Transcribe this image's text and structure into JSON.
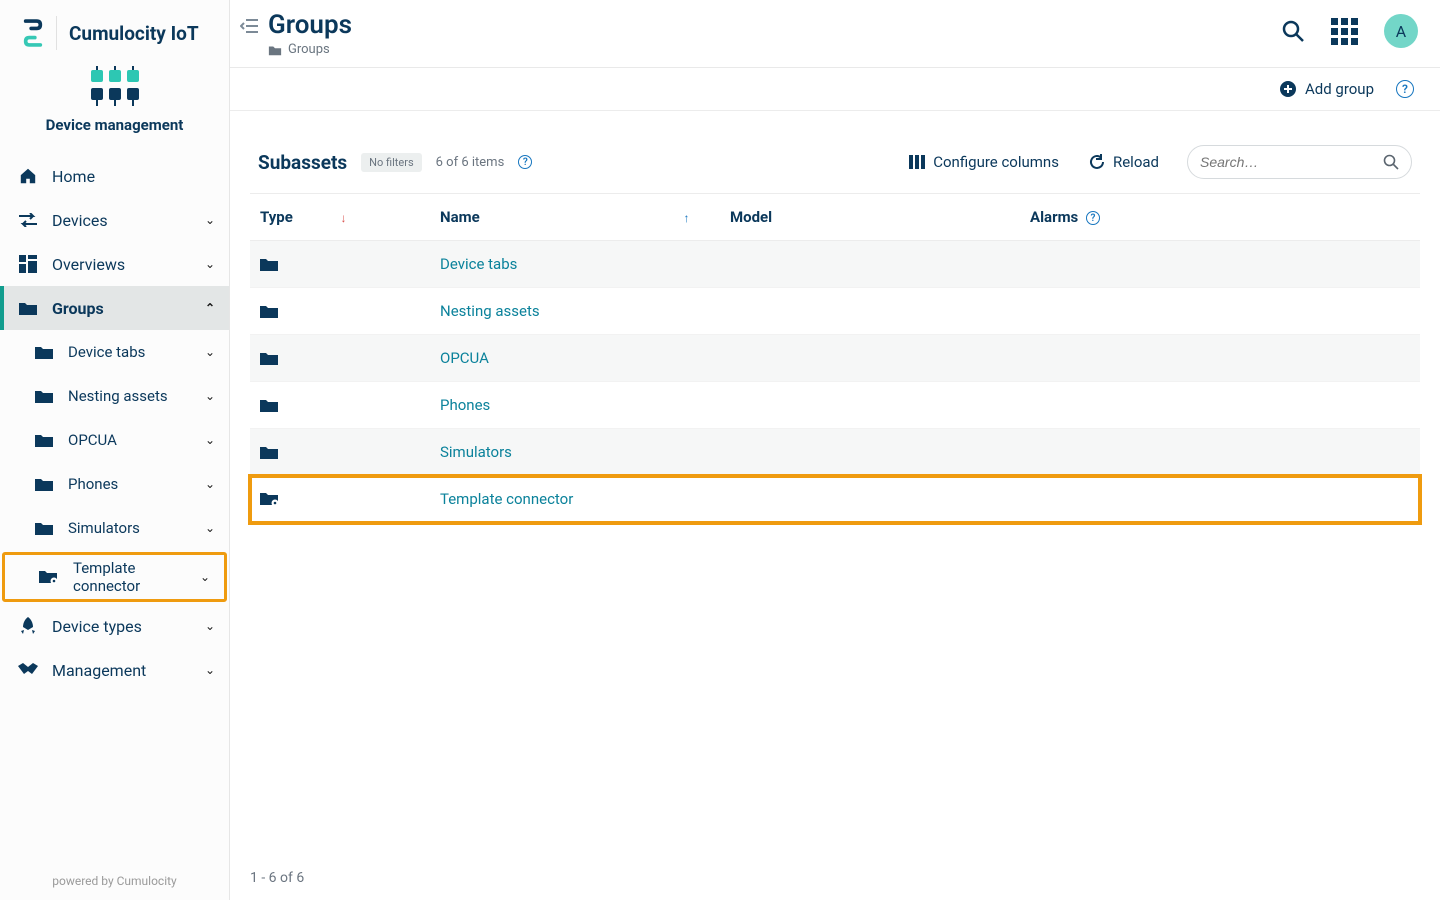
{
  "brand": {
    "name": "Cumulocity IoT"
  },
  "module": {
    "label": "Device management"
  },
  "nav": [
    {
      "label": "Home",
      "icon": "home",
      "expandable": false
    },
    {
      "label": "Devices",
      "icon": "swap",
      "expandable": true
    },
    {
      "label": "Overviews",
      "icon": "dashboard",
      "expandable": true
    },
    {
      "label": "Groups",
      "icon": "folder",
      "expandable": true,
      "active": true,
      "expanded": true,
      "children": [
        {
          "label": "Device tabs",
          "icon": "folder"
        },
        {
          "label": "Nesting assets",
          "icon": "folder"
        },
        {
          "label": "OPCUA",
          "icon": "folder"
        },
        {
          "label": "Phones",
          "icon": "folder"
        },
        {
          "label": "Simulators",
          "icon": "folder"
        },
        {
          "label": "Template connector",
          "icon": "folder-gear",
          "highlight": true
        }
      ]
    },
    {
      "label": "Device types",
      "icon": "rocket",
      "expandable": true
    },
    {
      "label": "Management",
      "icon": "handshake",
      "expandable": true
    }
  ],
  "footer": {
    "powered": "powered by Cumulocity"
  },
  "header": {
    "title": "Groups",
    "crumb": "Groups",
    "avatar": "A"
  },
  "actionbar": {
    "add_group": "Add group"
  },
  "panel": {
    "title": "Subassets",
    "no_filters": "No filters",
    "count": "6 of 6 items",
    "configure": "Configure columns",
    "reload": "Reload",
    "search_placeholder": "Search…"
  },
  "columns": {
    "type": "Type",
    "name": "Name",
    "model": "Model",
    "alarms": "Alarms"
  },
  "rows": [
    {
      "name": "Device tabs"
    },
    {
      "name": "Nesting assets"
    },
    {
      "name": "OPCUA"
    },
    {
      "name": "Phones"
    },
    {
      "name": "Simulators"
    },
    {
      "name": "Template connector",
      "highlight": true,
      "icon": "folder-gear"
    }
  ],
  "pager": "1 - 6 of 6"
}
